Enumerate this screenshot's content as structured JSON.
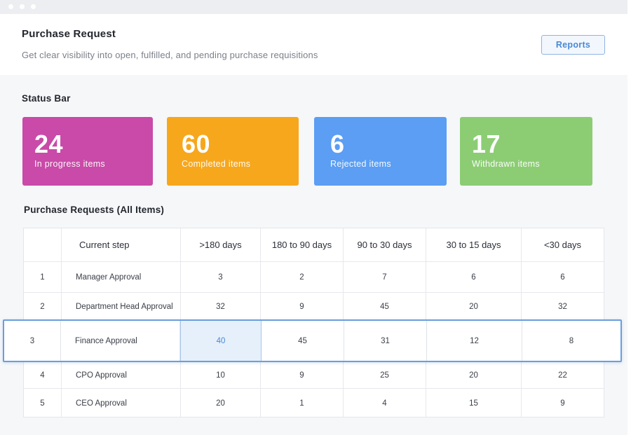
{
  "header": {
    "title": "Purchase Request",
    "subtitle": "Get clear visibility into open, fulfilled, and pending purchase requisitions",
    "reports_label": "Reports"
  },
  "status_bar": {
    "title": "Status Bar",
    "cards": [
      {
        "value": "24",
        "label": "In progress items",
        "color": "#c94aa8"
      },
      {
        "value": "60",
        "label": "Completed items",
        "color": "#f7a71c"
      },
      {
        "value": "6",
        "label": "Rejected items",
        "color": "#5b9ef3"
      },
      {
        "value": "17",
        "label": "Withdrawn items",
        "color": "#8ccd74"
      }
    ]
  },
  "table": {
    "title": "Purchase Requests (All Items)",
    "columns": [
      "",
      "Current step",
      ">180 days",
      "180 to 90 days",
      "90 to 30 days",
      "30 to 15 days",
      "<30 days"
    ],
    "rows": [
      {
        "index": "1",
        "step": "Manager Approval",
        "values": [
          "3",
          "2",
          "7",
          "6",
          "6"
        ]
      },
      {
        "index": "2",
        "step": "Department Head Approval",
        "values": [
          "32",
          "9",
          "45",
          "20",
          "32"
        ]
      },
      {
        "index": "3",
        "step": "Finance Approval",
        "values": [
          "40",
          "45",
          "31",
          "12",
          "8"
        ]
      },
      {
        "index": "4",
        "step": "CPO Approval",
        "values": [
          "10",
          "9",
          "25",
          "20",
          "22"
        ]
      },
      {
        "index": "5",
        "step": "CEO Approval",
        "values": [
          "20",
          "1",
          "4",
          "15",
          "9"
        ]
      }
    ],
    "highlighted_row": 2,
    "selected_column": 0,
    "accent_color": "#4a88d4"
  }
}
